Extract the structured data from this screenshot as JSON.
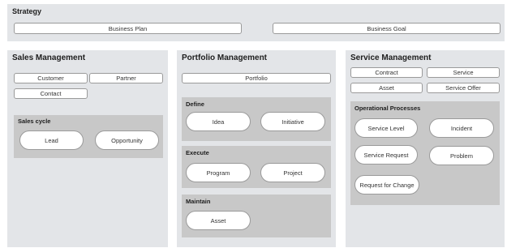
{
  "strategy": {
    "title": "Strategy",
    "items": [
      "Business Plan",
      "Business Goal"
    ]
  },
  "sales": {
    "title": "Sales Management",
    "items": [
      "Customer",
      "Partner",
      "Contact"
    ],
    "cycle": {
      "title": "Sales cycle",
      "items": [
        "Lead",
        "Opportunity"
      ]
    }
  },
  "portfolio": {
    "title": "Portfolio Management",
    "items": [
      "Portfolio"
    ],
    "define": {
      "title": "Define",
      "items": [
        "Idea",
        "Initiative"
      ]
    },
    "execute": {
      "title": "Execute",
      "items": [
        "Program",
        "Project"
      ]
    },
    "maintain": {
      "title": "Maintain",
      "items": [
        "Asset"
      ]
    }
  },
  "service": {
    "title": "Service Management",
    "items": [
      "Contract",
      "Service",
      "Asset",
      "Service Offer"
    ],
    "processes": {
      "title": "Operational Processes",
      "items": [
        "Service Level",
        "Incident",
        "Service Request",
        "Problem",
        "Request for Change"
      ]
    }
  }
}
